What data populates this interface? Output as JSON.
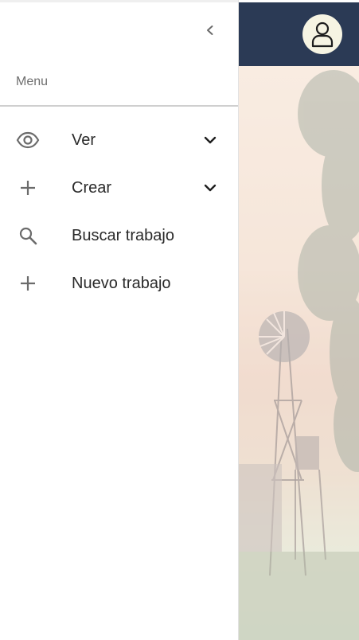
{
  "drawer": {
    "menu_label": "Menu",
    "items": [
      {
        "label": "Ver",
        "icon": "eye-icon",
        "expandable": true
      },
      {
        "label": "Crear",
        "icon": "plus-icon",
        "expandable": true
      },
      {
        "label": "Buscar trabajo",
        "icon": "search-icon",
        "expandable": false
      },
      {
        "label": "Nuevo trabajo",
        "icon": "plus-icon",
        "expandable": false
      }
    ]
  },
  "header": {
    "background_color": "#2b3a55",
    "avatar_icon": "user-icon"
  },
  "colors": {
    "icon": "#6b6b6b",
    "text": "#2a2a2a"
  }
}
